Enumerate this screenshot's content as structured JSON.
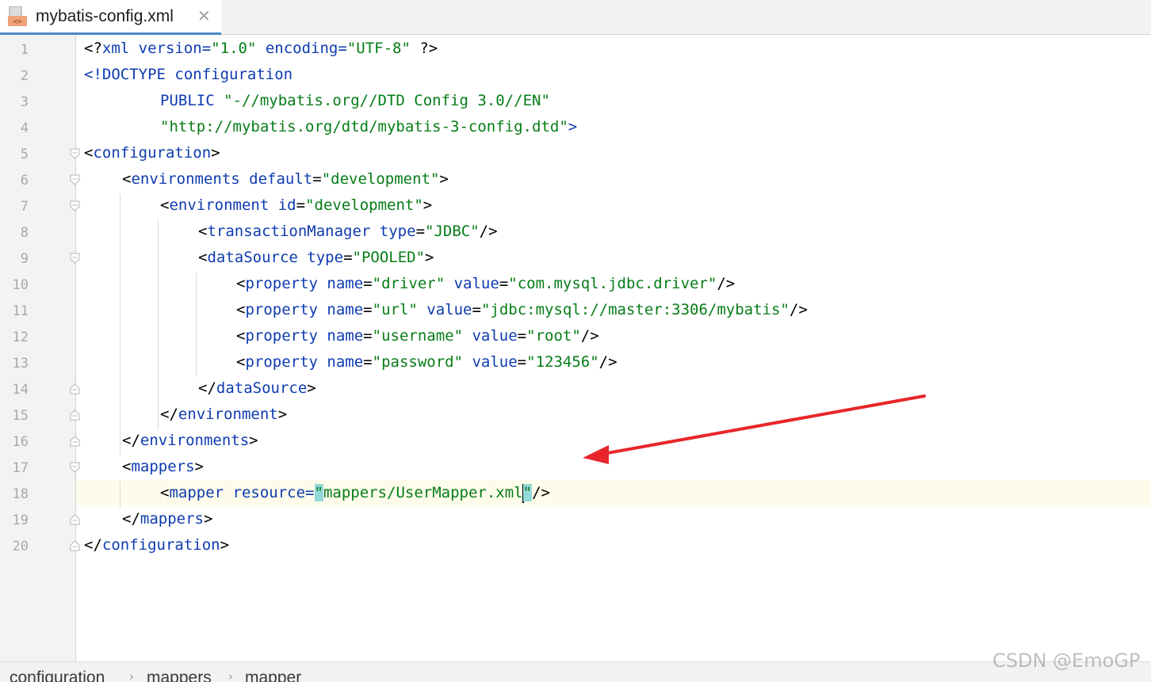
{
  "tab": {
    "title": "mybatis-config.xml",
    "close": "✕",
    "icon": "xml-file-icon"
  },
  "editor": {
    "current_line": 18,
    "lines": [
      {
        "n": "1"
      },
      {
        "n": "2"
      },
      {
        "n": "3"
      },
      {
        "n": "4"
      },
      {
        "n": "5"
      },
      {
        "n": "6"
      },
      {
        "n": "7"
      },
      {
        "n": "8"
      },
      {
        "n": "9"
      },
      {
        "n": "10"
      },
      {
        "n": "11"
      },
      {
        "n": "12"
      },
      {
        "n": "13"
      },
      {
        "n": "14"
      },
      {
        "n": "15"
      },
      {
        "n": "16"
      },
      {
        "n": "17"
      },
      {
        "n": "18"
      },
      {
        "n": "19"
      },
      {
        "n": "20"
      }
    ],
    "code": {
      "l1": [
        "<?",
        "xml ",
        "version",
        "=",
        "\"1.0\"",
        " ",
        "encoding",
        "=",
        "\"UTF-8\"",
        " ?>"
      ],
      "l2": [
        "<!DOCTYPE configuration"
      ],
      "l3": [
        "PUBLIC ",
        "\"-//mybatis.org//DTD Config 3.0//EN\""
      ],
      "l4": [
        "\"http://mybatis.org/dtd/mybatis-3-config.dtd\"",
        ">"
      ],
      "l5": [
        "<",
        "configuration",
        ">"
      ],
      "l6": [
        "<",
        "environments ",
        "default",
        "=",
        "\"development\"",
        ">"
      ],
      "l7": [
        "<",
        "environment ",
        "id",
        "=",
        "\"development\"",
        ">"
      ],
      "l8": [
        "<",
        "transactionManager ",
        "type",
        "=",
        "\"JDBC\"",
        "/>"
      ],
      "l9": [
        "<",
        "dataSource ",
        "type",
        "=",
        "\"POOLED\"",
        ">"
      ],
      "l10": [
        "<",
        "property ",
        "name",
        "=",
        "\"driver\"",
        " ",
        "value",
        "=",
        "\"com.mysql.jdbc.driver\"",
        "/>"
      ],
      "l11": [
        "<",
        "property ",
        "name",
        "=",
        "\"url\"",
        " ",
        "value",
        "=",
        "\"jdbc:mysql://master:3306/mybatis\"",
        "/>"
      ],
      "l12": [
        "<",
        "property ",
        "name",
        "=",
        "\"username\"",
        " ",
        "value",
        "=",
        "\"root\"",
        "/>"
      ],
      "l13": [
        "<",
        "property ",
        "name",
        "=",
        "\"password\"",
        " ",
        "value",
        "=",
        "\"123456\"",
        "/>"
      ],
      "l14": [
        "</",
        "dataSource",
        ">"
      ],
      "l15": [
        "</",
        "environment",
        ">"
      ],
      "l16": [
        "</",
        "environments",
        ">"
      ],
      "l17": [
        "<",
        "mappers",
        ">"
      ],
      "l18": [
        "<",
        "mapper ",
        "resource",
        "=",
        "\"",
        "mappers/UserMapper.xml",
        "\"",
        "/>"
      ],
      "l19": [
        "</",
        "mappers",
        ">"
      ],
      "l20": [
        "</",
        "configuration",
        ">"
      ]
    }
  },
  "breadcrumb": {
    "items": [
      "configuration",
      "mappers",
      "mapper"
    ],
    "separator": "›"
  },
  "watermark": "CSDN @EmoGP",
  "colors": {
    "tag": "#0e3bb0",
    "string": "#067d17",
    "accent": "#4a88c7",
    "arrow": "#e8262a",
    "match_highlight": "#93d9d9"
  }
}
